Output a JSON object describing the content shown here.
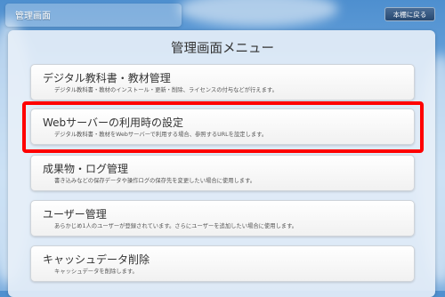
{
  "header": {
    "title": "管理画面",
    "back_label": "本棚に戻る"
  },
  "panel": {
    "title": "管理画面メニュー"
  },
  "menu": [
    {
      "title": "デジタル教科書・教材管理",
      "description": "デジタル教科書・教材のインストール・更新・削除、ライセンスの付与などが行えます。"
    },
    {
      "title": "Webサーバーの利用時の設定",
      "description": "デジタル教科書・教材をWebサーバーで利用する場合、参照するURLを設定します。"
    },
    {
      "title": "成果物・ログ管理",
      "description": "書き込みなどの保存データや操作ログの保存先を変更したい場合に使用します。"
    },
    {
      "title": "ユーザー管理",
      "description": "あらかじめ1人のユーザーが登録されています。さらにユーザーを追加したい場合に使用します。"
    },
    {
      "title": "キャッシュデータ削除",
      "description": "キャッシュデータを削除します。"
    }
  ],
  "colors": {
    "highlight": "#ff0000",
    "sky": "#6ea7de"
  }
}
